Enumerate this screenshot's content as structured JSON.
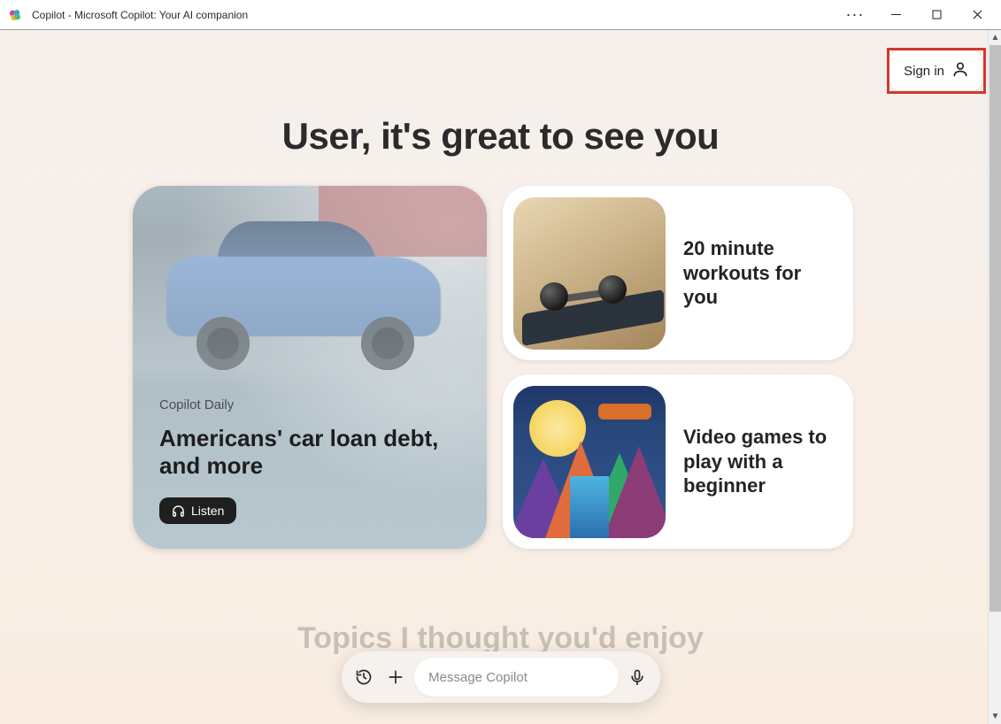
{
  "window": {
    "title": "Copilot - Microsoft Copilot: Your AI companion"
  },
  "header": {
    "sign_in_label": "Sign in"
  },
  "greeting": "User, it's great to see you",
  "hero": {
    "kicker": "Copilot Daily",
    "headline": "Americans' car loan debt, and more",
    "listen_label": "Listen"
  },
  "side_cards": [
    {
      "title": "20 minute workouts for you"
    },
    {
      "title": "Video games to play with a beginner"
    }
  ],
  "teaser_heading": "Topics I thought you'd enjoy",
  "compose": {
    "placeholder": "Message Copilot"
  }
}
